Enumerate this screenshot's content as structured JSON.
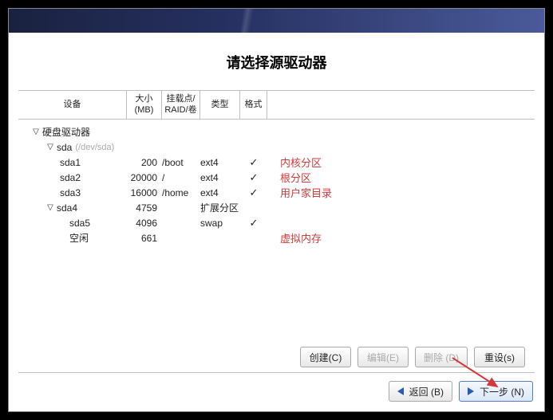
{
  "title": "请选择源驱动器",
  "columns": {
    "device": "设备",
    "size": "大小\n(MB)",
    "mount": "挂载点/\nRAID/卷",
    "type": "类型",
    "format": "格式"
  },
  "tree": {
    "root_label": "硬盘驱动器",
    "sda": {
      "label": "sda",
      "subpath": "(/dev/sda)",
      "children": [
        {
          "dev": "sda1",
          "size": "200",
          "mount": "/boot",
          "type": "ext4",
          "fmt": true,
          "ann": "内核分区"
        },
        {
          "dev": "sda2",
          "size": "20000",
          "mount": "/",
          "type": "ext4",
          "fmt": true,
          "ann": "根分区"
        },
        {
          "dev": "sda3",
          "size": "16000",
          "mount": "/home",
          "type": "ext4",
          "fmt": true,
          "ann": "用户家目录"
        },
        {
          "dev": "sda4",
          "size": "4759",
          "mount": "",
          "type": "扩展分区",
          "fmt": false,
          "ann": "",
          "expandable": true,
          "children": [
            {
              "dev": "sda5",
              "size": "4096",
              "mount": "",
              "type": "swap",
              "fmt": true,
              "ann": ""
            },
            {
              "dev": "空闲",
              "size": "661",
              "mount": "",
              "type": "",
              "fmt": false,
              "ann": "虚拟内存",
              "ann_above_gap": true
            }
          ]
        }
      ]
    }
  },
  "buttons": {
    "create": "创建(C)",
    "edit": "编辑(E)",
    "delete": "删除 (D)",
    "reset": "重设(s)",
    "back": "返回 (B)",
    "next": "下一步 (N)"
  }
}
